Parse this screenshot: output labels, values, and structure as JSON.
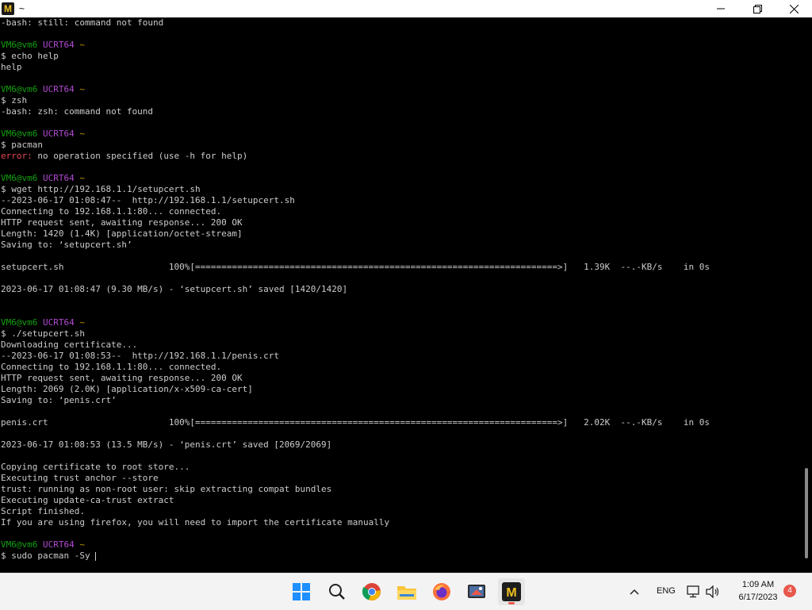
{
  "window": {
    "title": "~",
    "app_icon_letter": "M"
  },
  "prompt": {
    "user": "VM6@vm6",
    "env": "UCRT64",
    "dir": "~"
  },
  "terminal": {
    "l01": "-bash: still: command not found",
    "l04": "$ echo help",
    "l05": "help",
    "l08": "$ zsh",
    "l09": "-bash: zsh: command not found",
    "l12": "$ pacman",
    "l13_err": "error:",
    "l13_rest": " no operation specified (use -h for help)",
    "l16": "$ wget http://192.168.1.1/setupcert.sh",
    "l17": "--2023-06-17 01:08:47--  http://192.168.1.1/setupcert.sh",
    "l18": "Connecting to 192.168.1.1:80... connected.",
    "l19": "HTTP request sent, awaiting response... 200 OK",
    "l20": "Length: 1420 (1.4K) [application/octet-stream]",
    "l21": "Saving to: ‘setupcert.sh’",
    "l23": "setupcert.sh                    100%[=====================================================================>]   1.39K  --.-KB/s    in 0s",
    "l25": "2023-06-17 01:08:47 (9.30 MB/s) - ‘setupcert.sh’ saved [1420/1420]",
    "l30": "$ ./setupcert.sh",
    "l31": "Downloading certificate...",
    "l32": "--2023-06-17 01:08:53--  http://192.168.1.1/penis.crt",
    "l33": "Connecting to 192.168.1.1:80... connected.",
    "l34": "HTTP request sent, awaiting response... 200 OK",
    "l35": "Length: 2069 (2.0K) [application/x-x509-ca-cert]",
    "l36": "Saving to: ‘penis.crt’",
    "l38": "penis.crt                       100%[=====================================================================>]   2.02K  --.-KB/s    in 0s",
    "l40": "2023-06-17 01:08:53 (13.5 MB/s) - ‘penis.crt’ saved [2069/2069]",
    "l42": "Copying certificate to root store...",
    "l43": "Executing trust anchor --store",
    "l44": "trust: running as non-root user: skip extracting compat bundles",
    "l45": "Executing update-ca-trust extract",
    "l46": "Script finished.",
    "l47": "If you are using firefox, you will need to import the certificate manually",
    "l50": "$ sudo pacman -Sy "
  },
  "taskbar": {
    "apps": [
      "windows-start",
      "search",
      "chrome",
      "file-explorer",
      "firefox",
      "snipping-tool",
      "msys2-terminal"
    ],
    "active_app": "msys2-terminal",
    "language": "ENG",
    "time": "1:09 AM",
    "date": "6/17/2023",
    "notification_count": "4"
  },
  "colors": {
    "prompt_user": "#13a10e",
    "prompt_env": "#b14ad1",
    "prompt_dir": "#c19c00",
    "error": "#e74856",
    "text": "#cccccc"
  }
}
